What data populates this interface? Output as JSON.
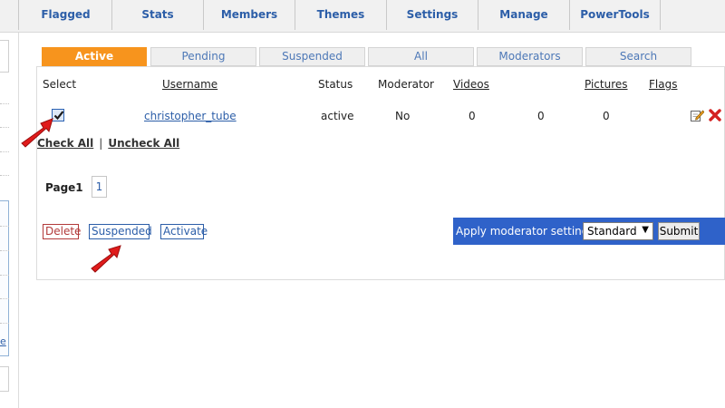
{
  "top_nav": {
    "items": [
      {
        "label": "Flagged"
      },
      {
        "label": "Stats"
      },
      {
        "label": "Members"
      },
      {
        "label": "Themes"
      },
      {
        "label": "Settings"
      },
      {
        "label": "Manage"
      },
      {
        "label": "PowerTools"
      }
    ]
  },
  "sidebar": {
    "link_fragment": "e"
  },
  "filter_tabs": [
    {
      "label": "Active",
      "selected": true
    },
    {
      "label": "Pending",
      "selected": false
    },
    {
      "label": "Suspended",
      "selected": false
    },
    {
      "label": "All",
      "selected": false
    },
    {
      "label": "Moderators",
      "selected": false
    },
    {
      "label": "Search",
      "selected": false
    }
  ],
  "table": {
    "headers": {
      "select": "Select",
      "username": "Username",
      "status": "Status",
      "moderator": "Moderator",
      "videos": "Videos",
      "pictures": "Pictures",
      "flags": "Flags"
    },
    "rows": [
      {
        "checked": true,
        "username": "christopher_tube",
        "status": "active",
        "moderator": "No",
        "videos": "0",
        "extra": "0",
        "pictures": "0"
      }
    ]
  },
  "bulk": {
    "check_all": "Check All",
    "separator": "|",
    "uncheck_all": "Uncheck All"
  },
  "pagination": {
    "label": "Page1",
    "pages": [
      "1"
    ]
  },
  "actions": {
    "delete": "Delete",
    "suspended": "Suspended",
    "activate": "Activate"
  },
  "moderator_settings": {
    "label": "Apply moderator settings",
    "selected": "Standard",
    "submit": "Submit"
  },
  "icons": {
    "edit": "edit-icon",
    "delete": "delete-x-icon",
    "arrow": "red-pointer-arrow"
  },
  "colors": {
    "active_tab": "#f7941d",
    "link_blue": "#2c5ea8",
    "moderator_bar": "#2f62c9",
    "delete_red": "#b23a3a",
    "annotation_red": "#e01b1b"
  }
}
